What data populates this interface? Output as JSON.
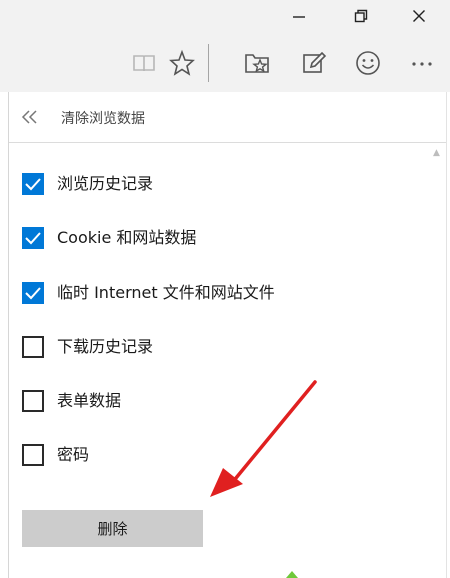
{
  "window": {
    "minimize_icon": "minimize-icon",
    "restore_icon": "restore-icon",
    "close_icon": "close-icon"
  },
  "toolbar": {
    "icons": [
      "reading-view-icon",
      "favorites-star-icon",
      "hub-icon",
      "web-note-icon",
      "feedback-smiley-icon",
      "more-icon"
    ],
    "more_label": "···"
  },
  "panel": {
    "back_label": "«",
    "title": "清除浏览数据",
    "options": [
      {
        "label": "浏览历史记录",
        "checked": true
      },
      {
        "label": "Cookie 和网站数据",
        "checked": true
      },
      {
        "label": "临时 Internet 文件和网站文件",
        "checked": true
      },
      {
        "label": "下载历史记录",
        "checked": false
      },
      {
        "label": "表单数据",
        "checked": false
      },
      {
        "label": "密码",
        "checked": false
      }
    ],
    "delete_label": "删除"
  },
  "colors": {
    "accent": "#0078d7",
    "toolbar_bg": "#f2f2f2",
    "button_bg": "#cccccc",
    "annotation": "#e02020"
  }
}
